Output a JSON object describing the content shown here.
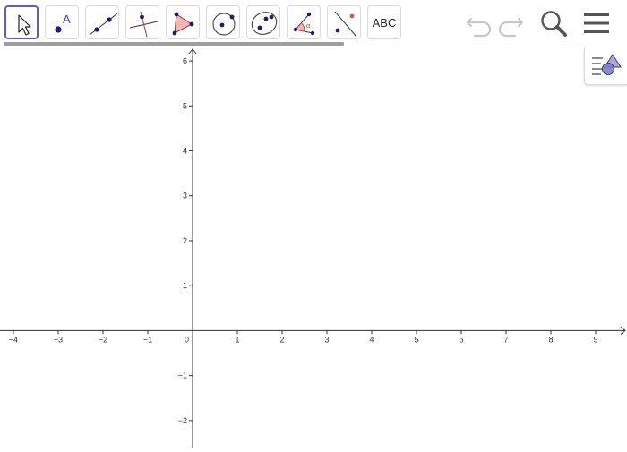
{
  "toolbar": {
    "tools": [
      {
        "name": "move-tool",
        "selected": true
      },
      {
        "name": "point-tool"
      },
      {
        "name": "line-tool"
      },
      {
        "name": "perpendicular-line-tool"
      },
      {
        "name": "polygon-tool"
      },
      {
        "name": "circle-tool"
      },
      {
        "name": "conic-tool"
      },
      {
        "name": "angle-tool"
      },
      {
        "name": "reflect-tool"
      },
      {
        "name": "text-tool",
        "label": "ABC"
      }
    ],
    "point_tool_letter": "A",
    "angle_tool_letter": "α",
    "right_icons": [
      "undo-icon",
      "redo-icon",
      "search-icon",
      "menu-icon"
    ]
  },
  "graphics": {
    "x_range": [
      -4.3,
      9.7
    ],
    "y_range": [
      -2.6,
      6.3
    ],
    "x_ticks": [
      "−4",
      "−3",
      "−2",
      "−1",
      "0",
      "1",
      "2",
      "3",
      "4",
      "5",
      "6",
      "7",
      "8",
      "9"
    ],
    "y_ticks": [
      "−2",
      "−1",
      "1",
      "2",
      "3",
      "4",
      "5",
      "6"
    ]
  },
  "style_bar_icon": "style-bar-toggle-icon",
  "colors": {
    "accent": "#6557d2",
    "point": "#1a1a7a",
    "polygon_fill": "#f4b6b6",
    "angle_mark": "#d9534f"
  }
}
